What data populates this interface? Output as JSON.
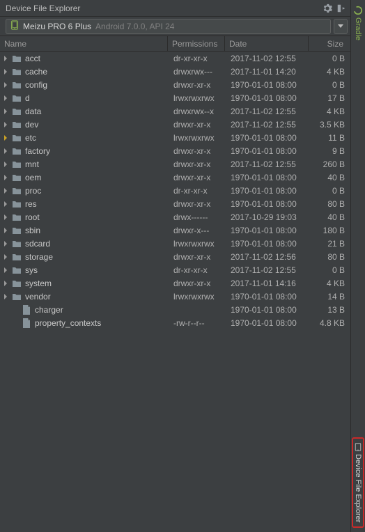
{
  "panel": {
    "title": "Device File Explorer"
  },
  "device": {
    "name": "Meizu PRO 6 Plus",
    "detail": "Android 7.0.0, API 24"
  },
  "columns": {
    "name": "Name",
    "permissions": "Permissions",
    "date": "Date",
    "size": "Size"
  },
  "rows": [
    {
      "depth": 0,
      "type": "dir",
      "chev": "right",
      "name": "acct",
      "perm": "dr-xr-xr-x",
      "date": "2017-11-02 12:55",
      "size": "0 B"
    },
    {
      "depth": 0,
      "type": "dir",
      "chev": "right",
      "name": "cache",
      "perm": "drwxrwx---",
      "date": "2017-11-01 14:20",
      "size": "4 KB"
    },
    {
      "depth": 0,
      "type": "dir",
      "chev": "right",
      "name": "config",
      "perm": "drwxr-xr-x",
      "date": "1970-01-01 08:00",
      "size": "0 B"
    },
    {
      "depth": 0,
      "type": "dir",
      "chev": "right",
      "name": "d",
      "perm": "lrwxrwxrwx",
      "date": "1970-01-01 08:00",
      "size": "17 B"
    },
    {
      "depth": 0,
      "type": "dir",
      "chev": "right",
      "name": "data",
      "perm": "drwxrwx--x",
      "date": "2017-11-02 12:55",
      "size": "4 KB"
    },
    {
      "depth": 0,
      "type": "dir",
      "chev": "right",
      "name": "dev",
      "perm": "drwxr-xr-x",
      "date": "2017-11-02 12:55",
      "size": "3.5 KB"
    },
    {
      "depth": 0,
      "type": "dir",
      "chev": "hl",
      "name": "etc",
      "perm": "lrwxrwxrwx",
      "date": "1970-01-01 08:00",
      "size": "11 B"
    },
    {
      "depth": 0,
      "type": "dir",
      "chev": "right",
      "name": "factory",
      "perm": "drwxr-xr-x",
      "date": "1970-01-01 08:00",
      "size": "9 B"
    },
    {
      "depth": 0,
      "type": "dir",
      "chev": "right",
      "name": "mnt",
      "perm": "drwxr-xr-x",
      "date": "2017-11-02 12:55",
      "size": "260 B"
    },
    {
      "depth": 0,
      "type": "dir",
      "chev": "right",
      "name": "oem",
      "perm": "drwxr-xr-x",
      "date": "1970-01-01 08:00",
      "size": "40 B"
    },
    {
      "depth": 0,
      "type": "dir",
      "chev": "right",
      "name": "proc",
      "perm": "dr-xr-xr-x",
      "date": "1970-01-01 08:00",
      "size": "0 B"
    },
    {
      "depth": 0,
      "type": "dir",
      "chev": "right",
      "name": "res",
      "perm": "drwxr-xr-x",
      "date": "1970-01-01 08:00",
      "size": "80 B"
    },
    {
      "depth": 0,
      "type": "dir",
      "chev": "right",
      "name": "root",
      "perm": "drwx------",
      "date": "2017-10-29 19:03",
      "size": "40 B"
    },
    {
      "depth": 0,
      "type": "dir",
      "chev": "right",
      "name": "sbin",
      "perm": "drwxr-x---",
      "date": "1970-01-01 08:00",
      "size": "180 B"
    },
    {
      "depth": 0,
      "type": "dir",
      "chev": "right",
      "name": "sdcard",
      "perm": "lrwxrwxrwx",
      "date": "1970-01-01 08:00",
      "size": "21 B"
    },
    {
      "depth": 0,
      "type": "dir",
      "chev": "right",
      "name": "storage",
      "perm": "drwxr-xr-x",
      "date": "2017-11-02 12:56",
      "size": "80 B"
    },
    {
      "depth": 0,
      "type": "dir",
      "chev": "right",
      "name": "sys",
      "perm": "dr-xr-xr-x",
      "date": "2017-11-02 12:55",
      "size": "0 B"
    },
    {
      "depth": 0,
      "type": "dir",
      "chev": "right",
      "name": "system",
      "perm": "drwxr-xr-x",
      "date": "2017-11-01 14:16",
      "size": "4 KB"
    },
    {
      "depth": 0,
      "type": "dir",
      "chev": "right",
      "name": "vendor",
      "perm": "lrwxrwxrwx",
      "date": "1970-01-01 08:00",
      "size": "14 B"
    },
    {
      "depth": 1,
      "type": "file",
      "chev": "none",
      "name": "charger",
      "perm": "",
      "date": "1970-01-01 08:00",
      "size": "13 B"
    },
    {
      "depth": 1,
      "type": "file",
      "chev": "none",
      "name": "property_contexts",
      "perm": "-rw-r--r--",
      "date": "1970-01-01 08:00",
      "size": "4.8 KB"
    }
  ],
  "sidetabs": {
    "gradle": "Gradle",
    "dfe": "Device File Explorer"
  }
}
